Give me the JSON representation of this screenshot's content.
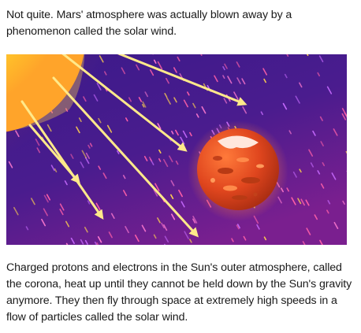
{
  "article": {
    "intro": "Not quite. Mars' atmosphere was actually blown away by a phenomenon called the solar wind.",
    "illustration": {
      "subject": "Sun emitting solar wind rays toward Mars",
      "icons": [
        "sun-icon",
        "mars-planet-icon",
        "solar-wind-arrow-icon",
        "particle-streak-icon"
      ],
      "colors": {
        "sky_top": "#3b1a8a",
        "sky_bottom": "#7a1f8f",
        "sun_core": "#fff4b0",
        "sun_glow": "#ffb21a",
        "ray": "#ffe98a",
        "mars_base": "#e0461e",
        "mars_light": "#ff7a3a",
        "mars_dark": "#a32a10",
        "streak_pink": "#ff5fa8",
        "streak_yellow": "#ffd24d"
      }
    },
    "explanation": "Charged protons and electrons in the Sun's outer atmosphere, called the corona, heat up until they cannot be held down by the Sun's gravity anymore. They then fly through space at extremely high speeds in a flow of particles called the solar wind."
  }
}
